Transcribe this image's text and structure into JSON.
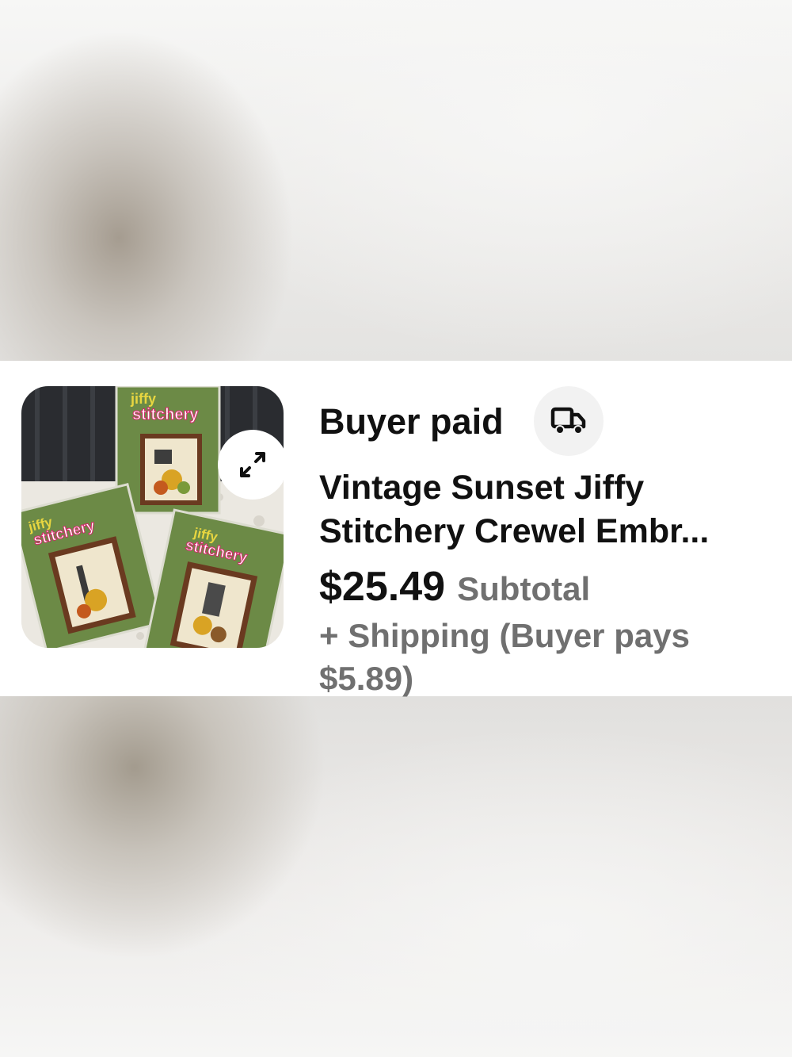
{
  "order": {
    "status": "Buyer paid",
    "title_lines": [
      "Vintage Sunset Jiffy",
      "Stitchery Crewel Embr..."
    ],
    "price": "$25.49",
    "price_label": "Subtotal",
    "shipping_lines": [
      "+ Shipping (Buyer pays",
      "$5.89)"
    ]
  },
  "image": {
    "alt": "Three Jiffy Stitchery crewel embroidery kits",
    "kit_brand_word_1": "jiffy",
    "kit_brand_word_2": "stitchery"
  },
  "icons": {
    "expand": "expand-arrows-icon",
    "shipping": "truck-icon"
  },
  "colors": {
    "text_primary": "#111111",
    "text_secondary": "#707070",
    "icon_bg": "#f2f2f2",
    "kit_green": "#6c8a46"
  }
}
